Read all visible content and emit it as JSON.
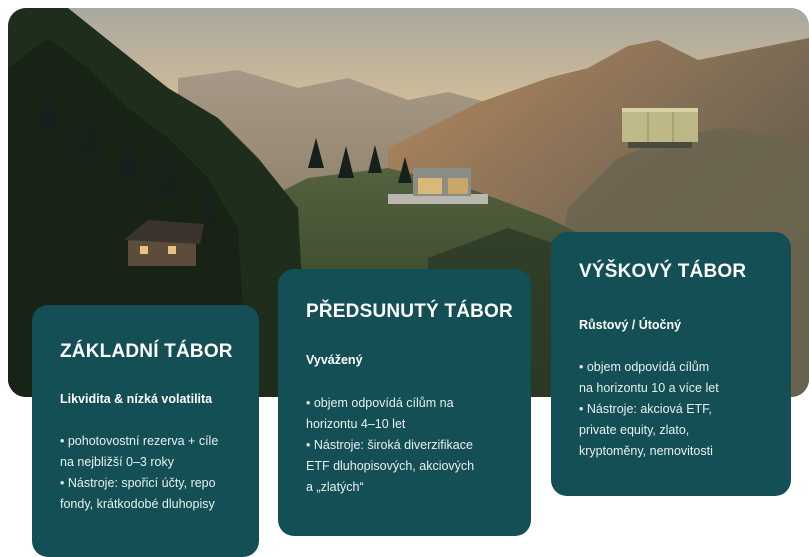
{
  "cards": [
    {
      "title": "ZÁKLADNÍ TÁBOR",
      "subtitle": "Likvidita & nízká volatilita",
      "lines": [
        " • pohotovostní rezerva + cíle",
        "na nejbližší 0–3 roky",
        " • Nástroje: spořicí účty, repo",
        "fondy, krátkodobé dluhopisy"
      ]
    },
    {
      "title": "PŘEDSUNUTÝ TÁBOR",
      "subtitle": "Vyvážený",
      "lines": [
        "• objem odpovídá cílům na",
        "horizontu 4–10 let",
        " • Nástroje: široká diverzifikace",
        "ETF dluhopisových, akciových",
        "a „zlatých“"
      ]
    },
    {
      "title": "VÝŠKOVÝ TÁBOR",
      "subtitle": "Růstový / Útočný",
      "lines": [
        " • objem odpovídá cílům",
        "na horizontu 10 a více let",
        " • Nástroje: akciová ETF,",
        "private equity, zlato,",
        "kryptoměny, nemovitosti"
      ]
    }
  ],
  "colors": {
    "card_bg": "#144f55",
    "card_text": "#ffffff"
  },
  "hero_image": "mountain-landscape-with-base-camps"
}
